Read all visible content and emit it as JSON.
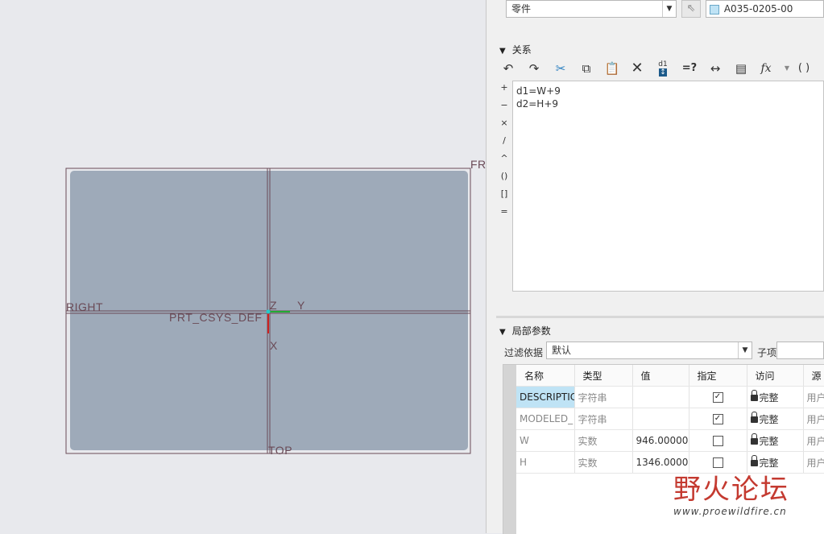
{
  "canvas": {
    "planes": {
      "front": "FR",
      "right": "RIGHT",
      "top": "TOP"
    },
    "csys": {
      "name": "PRT_CSYS_DEF",
      "z": "Z",
      "y": "Y",
      "x": "X"
    },
    "colors": {
      "part_fill": "#9eaab9",
      "datum": "#6a4a56"
    }
  },
  "header": {
    "type_combo": "零件",
    "model_name": "A035-0205-00"
  },
  "relations": {
    "title": "关系",
    "toolbar": [
      "undo-icon",
      "redo-icon",
      "cut-icon",
      "copy-icon",
      "paste-icon",
      "delete-icon",
      "sort-relations-icon",
      "evaluate-icon",
      "show-dimension-icon",
      "insert-from-list-icon",
      "function-icon",
      "bracket-icon"
    ],
    "toolbar_text": {
      "sort": "d1",
      "evaluate": "=?",
      "function": "fx",
      "bracket": "( )"
    },
    "operators": [
      "+",
      "−",
      "×",
      "/",
      "^",
      "()",
      "[]",
      "="
    ],
    "lines": [
      "d1=W+9",
      "d2=H+9"
    ]
  },
  "params": {
    "title": "局部参数",
    "filter_label": "过滤依据",
    "filter_value": "默认",
    "child_label": "子项",
    "columns": [
      "名称",
      "类型",
      "值",
      "指定",
      "访问",
      "源"
    ],
    "rows": [
      {
        "name": "DESCRIPTIC",
        "type": "字符串",
        "value": "",
        "designated": true,
        "access": "完整",
        "source": "用户"
      },
      {
        "name": "MODELED_",
        "type": "字符串",
        "value": "",
        "designated": true,
        "access": "完整",
        "source": "用户"
      },
      {
        "name": "W",
        "type": "实数",
        "value": "946.000000",
        "designated": false,
        "access": "完整",
        "source": "用户"
      },
      {
        "name": "H",
        "type": "实数",
        "value": "1346.00000",
        "designated": false,
        "access": "完整",
        "source": "用户"
      }
    ]
  },
  "watermark": {
    "title": "野火论坛",
    "url": "www.proewildfire.cn"
  }
}
